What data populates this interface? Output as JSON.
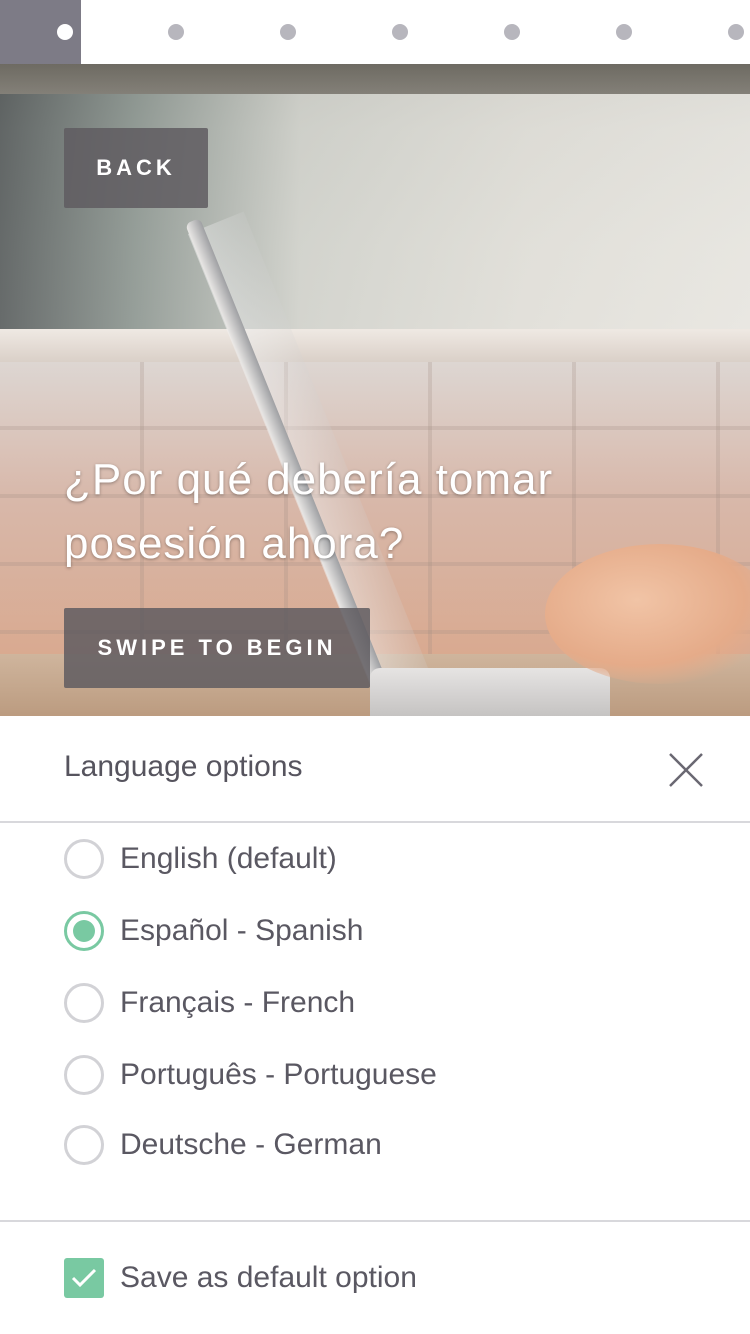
{
  "pager": {
    "count": 7,
    "active_index": 0
  },
  "hero": {
    "back_label": "BACK",
    "title": "¿Por qué debería tomar posesión ahora?",
    "swipe_label": "SWIPE TO BEGIN"
  },
  "language_panel": {
    "title": "Language options",
    "options": [
      {
        "label": "English (default)",
        "selected": false
      },
      {
        "label": "Español - Spanish",
        "selected": true
      },
      {
        "label": "Français - French",
        "selected": false
      },
      {
        "label": "Português - Portuguese",
        "selected": false
      },
      {
        "label": "Deutsche - German",
        "selected": false
      }
    ],
    "save_default_label": "Save as default option",
    "save_default_checked": true
  },
  "colors": {
    "accent": "#79c9a2",
    "pager_active": "#7d7b86",
    "dark_button": "#5f5c60"
  },
  "icons": {
    "close": "close-icon",
    "check": "checkmark-icon"
  }
}
